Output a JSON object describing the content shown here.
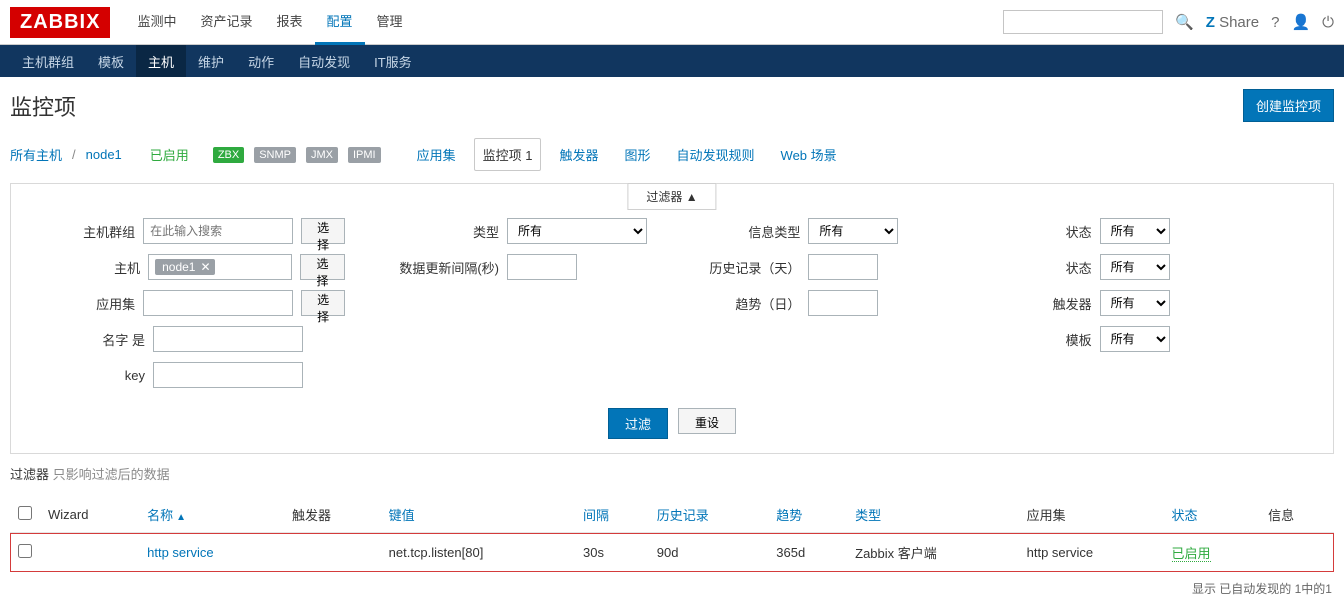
{
  "logo": "ZABBIX",
  "topnav": [
    "监测中",
    "资产记录",
    "报表",
    "配置",
    "管理"
  ],
  "topnav_active": 3,
  "share": "Share",
  "subnav": [
    "主机群组",
    "模板",
    "主机",
    "维护",
    "动作",
    "自动发现",
    "IT服务"
  ],
  "subnav_active": 2,
  "page_title": "监控项",
  "create_btn": "创建监控项",
  "crumb": {
    "all_hosts": "所有主机",
    "host": "node1",
    "enabled": "已启用"
  },
  "proto_tags": [
    "ZBX",
    "SNMP",
    "JMX",
    "IPMI"
  ],
  "tabs": [
    "应用集",
    "监控项 1",
    "触发器",
    "图形",
    "自动发现规则",
    "Web 场景"
  ],
  "tabs_active": 1,
  "filter_header": "过滤器 ▲",
  "filters": {
    "hostgroup_label": "主机群组",
    "hostgroup_ph": "在此输入搜索",
    "select_btn": "选择",
    "host_label": "主机",
    "host_chip": "node1",
    "app_label": "应用集",
    "name_label": "名字 是",
    "key_label": "key",
    "type_label": "类型",
    "type_val": "所有",
    "update_label": "数据更新间隔(秒)",
    "infotype_label": "信息类型",
    "infotype_val": "所有",
    "history_label": "历史记录（天）",
    "trend_label": "趋势（日）",
    "state1_label": "状态",
    "state1_val": "所有",
    "state2_label": "状态",
    "state2_val": "所有",
    "trigger_label": "触发器",
    "trigger_val": "所有",
    "template_label": "模板",
    "template_val": "所有"
  },
  "filter_btn": "过滤",
  "reset_btn": "重设",
  "note_lead": "过滤器",
  "note_rest": "只影响过滤后的数据",
  "cols": {
    "wizard": "Wizard",
    "name": "名称",
    "triggers": "触发器",
    "key": "键值",
    "interval": "间隔",
    "history": "历史记录",
    "trend": "趋势",
    "type": "类型",
    "app": "应用集",
    "status": "状态",
    "info": "信息"
  },
  "rows": [
    {
      "name": "http service",
      "key": "net.tcp.listen[80]",
      "interval": "30s",
      "history": "90d",
      "trend": "365d",
      "type": "Zabbix 客户端",
      "app": "http service",
      "status": "已启用"
    }
  ],
  "footer": "显示 已自动发现的 1中的1"
}
